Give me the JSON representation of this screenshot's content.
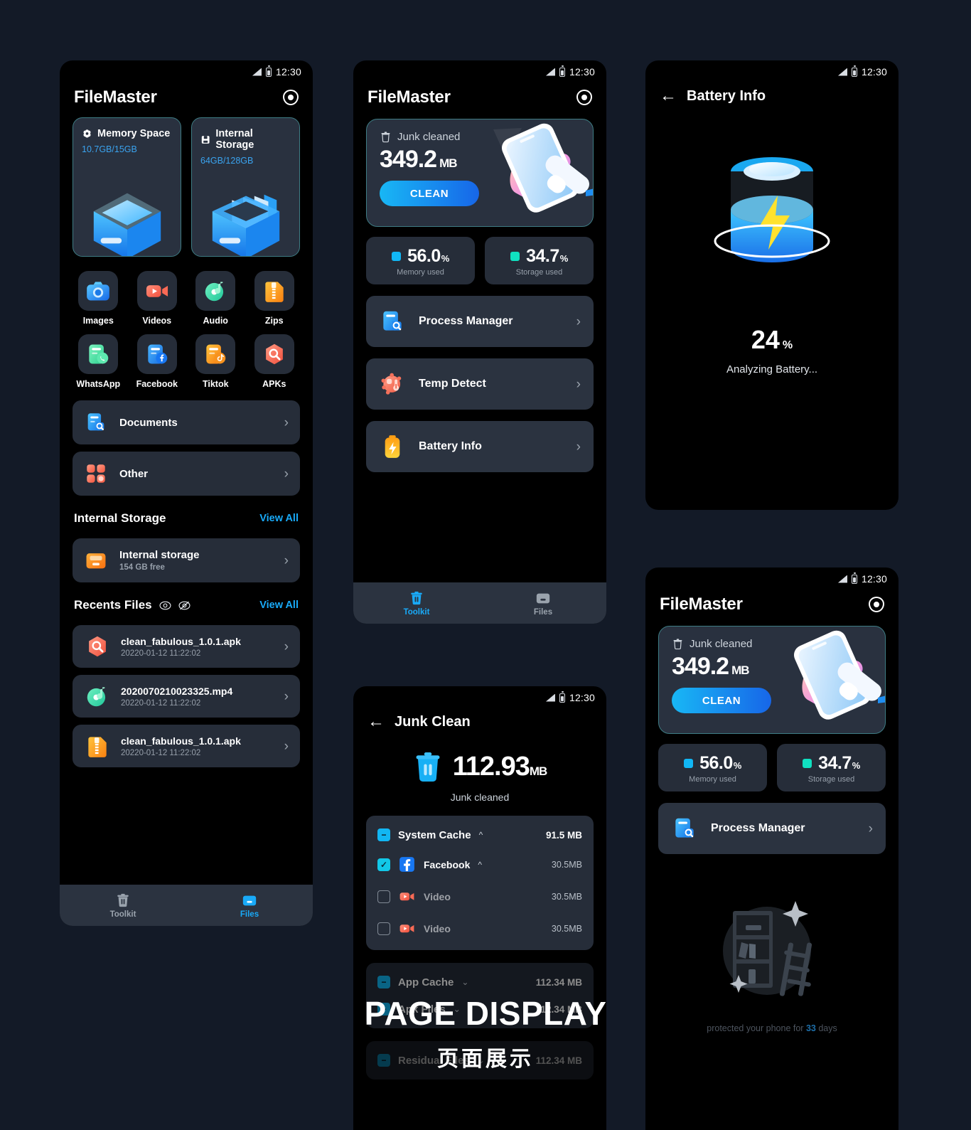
{
  "colors": {
    "page_bg": "#131a27",
    "screen_bg": "#000000",
    "card_bg": "#262d39",
    "accent_blue": "#19aaf8",
    "accent_cyan": "#12b6f3",
    "memory_dot": "#11b7f5",
    "storage_dot": "#10e0c0",
    "card_border": "#3e7c84"
  },
  "status_bar": {
    "time": "12:30",
    "signal_icon": "signal-icon",
    "battery_icon": "battery-icon"
  },
  "overlay": {
    "english": "PAGE DISPLAY",
    "chinese": "页面展示"
  },
  "home": {
    "title": "FileMaster",
    "settings_icon": "target-eye-icon",
    "storage_cards": [
      {
        "icon": "memory-chip-icon",
        "label": "Memory Space",
        "value": "10.7GB/15GB"
      },
      {
        "icon": "internal-storage-icon",
        "label": "Internal Storage",
        "value": "64GB/128GB"
      }
    ],
    "categories": [
      {
        "icon": "images-icon",
        "label": "Images"
      },
      {
        "icon": "videos-icon",
        "label": "Videos"
      },
      {
        "icon": "audio-icon",
        "label": "Audio"
      },
      {
        "icon": "zips-icon",
        "label": "Zips"
      },
      {
        "icon": "whatsapp-icon",
        "label": "WhatsApp"
      },
      {
        "icon": "facebook-icon",
        "label": "Facebook"
      },
      {
        "icon": "tiktok-icon",
        "label": "Tiktok"
      },
      {
        "icon": "apks-icon",
        "label": "APKs"
      }
    ],
    "quick_rows": [
      {
        "icon": "documents-icon",
        "label": "Documents"
      },
      {
        "icon": "other-icon",
        "label": "Other"
      }
    ],
    "internal_storage_section": {
      "title": "Internal Storage",
      "view_all": "View All",
      "item": {
        "icon": "folder-icon",
        "label": "Internal storage",
        "sub": "154 GB free"
      }
    },
    "recents_section": {
      "title": "Recents Files",
      "eye_icon": "eye-icon",
      "eye_off_icon": "eye-off-icon",
      "view_all": "View All",
      "files": [
        {
          "icon": "apks-icon",
          "name": "clean_fabulous_1.0.1.apk",
          "date": "20220-01-12 11:22:02"
        },
        {
          "icon": "audio-icon",
          "name": "2020070210023325.mp4",
          "date": "20220-01-12 11:22:02"
        },
        {
          "icon": "zips-icon",
          "name": "clean_fabulous_1.0.1.apk",
          "date": "20220-01-12 11:22:02"
        }
      ]
    },
    "bottom_nav": [
      {
        "icon": "trash-icon",
        "label": "Toolkit",
        "active": false
      },
      {
        "icon": "folder-nav-icon",
        "label": "Files",
        "active": true
      }
    ]
  },
  "toolkit": {
    "title": "FileMaster",
    "settings_icon": "target-eye-icon",
    "hero": {
      "trash_icon": "trash-outline-icon",
      "caption": "Junk cleaned",
      "value": "349.2",
      "unit": "MB",
      "button": "CLEAN"
    },
    "stats": [
      {
        "dot_color": "#11b7f5",
        "value": "56.0",
        "percent": "%",
        "label": "Memory used"
      },
      {
        "dot_color": "#10e0c0",
        "value": "34.7",
        "percent": "%",
        "label": "Storage used"
      }
    ],
    "tools": [
      {
        "icon": "process-manager-icon",
        "label": "Process Manager"
      },
      {
        "icon": "temp-detect-icon",
        "label": "Temp Detect"
      },
      {
        "icon": "battery-info-icon",
        "label": "Battery Info"
      }
    ],
    "bottom_nav": [
      {
        "icon": "trash-icon",
        "label": "Toolkit",
        "active": true
      },
      {
        "icon": "folder-nav-icon",
        "label": "Files",
        "active": false
      }
    ]
  },
  "battery_screen": {
    "back_icon": "back-arrow-icon",
    "title": "Battery Info",
    "art_icon": "battery-charging-icon",
    "percent": "24",
    "percent_symbol": "%",
    "status": "Analyzing Battery..."
  },
  "junk_clean": {
    "back_icon": "back-arrow-icon",
    "title": "Junk Clean",
    "trash_icon": "trash-filled-icon",
    "value": "112.93",
    "unit": "MB",
    "caption": "Junk cleaned",
    "groups": [
      {
        "checkbox": "minus",
        "name": "System Cache",
        "caret": "up",
        "size": "91.5 MB",
        "children": [
          {
            "checkbox": "checked",
            "icon": "facebook-app-icon",
            "name": "Facebook",
            "caret": "up",
            "size": "30.5MB",
            "dim": false
          },
          {
            "checkbox": "empty",
            "icon": "video-icon",
            "name": "Video",
            "caret": "",
            "size": "30.5MB",
            "dim": true
          },
          {
            "checkbox": "empty",
            "icon": "video-icon",
            "name": "Video",
            "caret": "",
            "size": "30.5MB",
            "dim": true
          }
        ]
      },
      {
        "checkbox": "minus",
        "name": "App Cache",
        "caret": "down",
        "size": "112.34 MB",
        "children": [],
        "dim": true
      },
      {
        "checkbox": "minus",
        "name": "Apk Files",
        "caret": "down",
        "size": "112.34 MB",
        "children": [],
        "dim": true
      },
      {
        "checkbox": "minus",
        "name": "Residual Files",
        "caret": "down",
        "size": "112.34 MB",
        "children": [],
        "dim": true
      }
    ]
  },
  "toolkit_empty": {
    "title": "FileMaster",
    "settings_icon": "target-eye-icon",
    "hero": {
      "trash_icon": "trash-outline-icon",
      "caption": "Junk cleaned",
      "value": "349.2",
      "unit": "MB",
      "button": "CLEAN"
    },
    "stats": [
      {
        "dot_color": "#11b7f5",
        "value": "56.0",
        "percent": "%",
        "label": "Memory used"
      },
      {
        "dot_color": "#10e0c0",
        "value": "34.7",
        "percent": "%",
        "label": "Storage used"
      }
    ],
    "tools": [
      {
        "icon": "process-manager-icon",
        "label": "Process Manager"
      }
    ],
    "empty_art_icon": "shelf-sparkle-icon",
    "protect_prefix": "protected your phone for ",
    "protect_days": "33",
    "protect_suffix": " days"
  }
}
